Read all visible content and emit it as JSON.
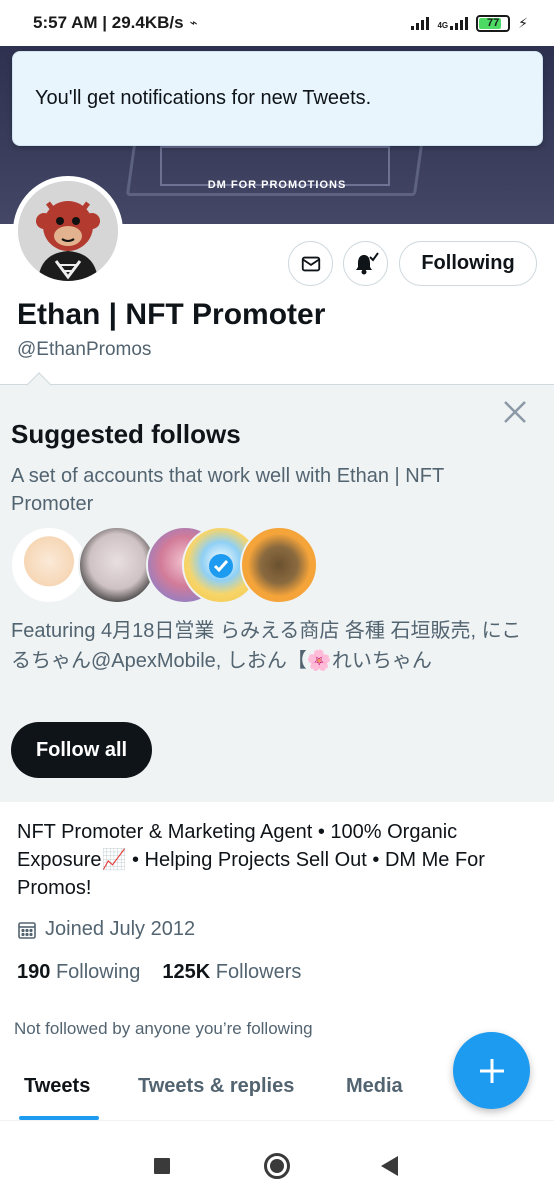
{
  "status_bar": {
    "time_speed": "5:57 AM | 29.4KB/s",
    "network": "4G",
    "battery": "77"
  },
  "toast": {
    "message": "You'll get notifications for new Tweets."
  },
  "banner": {
    "text": "DM FOR PROMOTIONS"
  },
  "profile": {
    "name": "Ethan | NFT Promoter",
    "handle": "@EthanPromos",
    "following_button": "Following",
    "bio": "NFT Promoter & Marketing Agent • 100% Organic Exposure📈 • Helping Projects Sell Out • DM Me For Promos!",
    "joined": "Joined July 2012",
    "following_count": "190",
    "following_label": "Following",
    "followers_count": "125K",
    "followers_label": "Followers",
    "not_followed": "Not followed by anyone you’re following"
  },
  "suggested": {
    "title": "Suggested follows",
    "description": "A set of accounts that work well with Ethan | NFT Promoter",
    "featuring": "Featuring 4月18日営業 らみえる商店 各種 石垣販売, にこるちゃん@ApexMobile, しおん【🌸れいちゃん",
    "follow_all": "Follow all"
  },
  "tabs": [
    {
      "label": "Tweets"
    },
    {
      "label": "Tweets & replies"
    },
    {
      "label": "Media"
    }
  ],
  "colors": {
    "accent": "#1d9bf0",
    "text_primary": "#0f1419",
    "text_secondary": "#536471",
    "card_bg": "#eff3f4",
    "toast_bg": "#e8f5fd"
  },
  "icons": {
    "mail": "mail-icon",
    "bell": "bell-check-icon",
    "close": "close-icon",
    "calendar": "calendar-icon",
    "compose": "plus-icon"
  }
}
